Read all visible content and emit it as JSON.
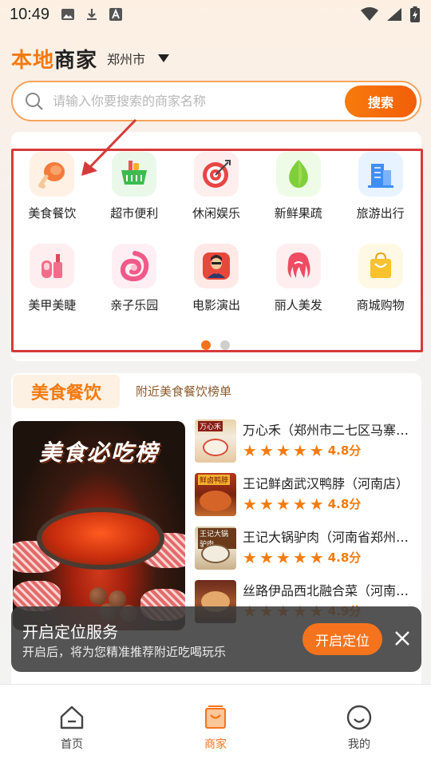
{
  "status_bar": {
    "time": "10:49"
  },
  "header": {
    "logo_part1": "本地",
    "logo_part2": "商家",
    "city": "郑州市"
  },
  "search": {
    "placeholder": "请输入你要搜索的商家名称",
    "button_label": "搜索"
  },
  "categories": [
    {
      "label": "美食餐饮",
      "icon": "drumstick-icon",
      "bg": "#fff1e4"
    },
    {
      "label": "超市便利",
      "icon": "shopping-basket-icon",
      "bg": "#e9f8e9"
    },
    {
      "label": "休闲娱乐",
      "icon": "target-icon",
      "bg": "#ffeeee"
    },
    {
      "label": "新鲜果疏",
      "icon": "leaf-icon",
      "bg": "#eefbe6"
    },
    {
      "label": "旅游出行",
      "icon": "building-icon",
      "bg": "#e7f3ff"
    },
    {
      "label": "美甲美睫",
      "icon": "nail-polish-icon",
      "bg": "#ffeef0"
    },
    {
      "label": "亲子乐园",
      "icon": "baby-icon",
      "bg": "#ffeef3"
    },
    {
      "label": "电影演出",
      "icon": "movie-icon",
      "bg": "#ffe9e6"
    },
    {
      "label": "丽人美发",
      "icon": "hair-icon",
      "bg": "#ffeef0"
    },
    {
      "label": "商城购物",
      "icon": "shopping-bag-icon",
      "bg": "#fff8e4"
    }
  ],
  "pager": {
    "pages": 2,
    "active": 0
  },
  "food_section": {
    "title": "美食餐饮",
    "subtitle": "附近美食餐饮榜单",
    "banner_title": "美食必吃榜",
    "items": [
      {
        "name": "万心禾（郑州市二七区马寨镇店）",
        "rating": "4.8分",
        "stars": 4.8,
        "thumb_tag": "万心禾"
      },
      {
        "name": "王记鲜卤武汉鸭脖（河南店）",
        "rating": "4.8分",
        "stars": 4.8,
        "thumb_tag": "鲜卤鸭脖"
      },
      {
        "name": "王记大锅驴肉（河南省郑州市店）",
        "rating": "4.8分",
        "stars": 4.8,
        "thumb_tag": "王记大锅驴肉"
      },
      {
        "name": "丝路伊品西北融合菜（河南店）",
        "rating": "4.9分",
        "stars": 4.9,
        "thumb_tag": ""
      }
    ]
  },
  "toast": {
    "title": "开启定位服务",
    "description": "开启后，将为您精准推荐附近吃喝玩乐",
    "button_label": "开启定位"
  },
  "bottom_nav": [
    {
      "label": "首页",
      "icon": "home-icon",
      "active": false
    },
    {
      "label": "商家",
      "icon": "shop-bag-icon",
      "active": true
    },
    {
      "label": "我的",
      "icon": "smile-icon",
      "active": false
    }
  ],
  "colors": {
    "accent": "#f5731c",
    "annotation": "#d63a3a"
  }
}
